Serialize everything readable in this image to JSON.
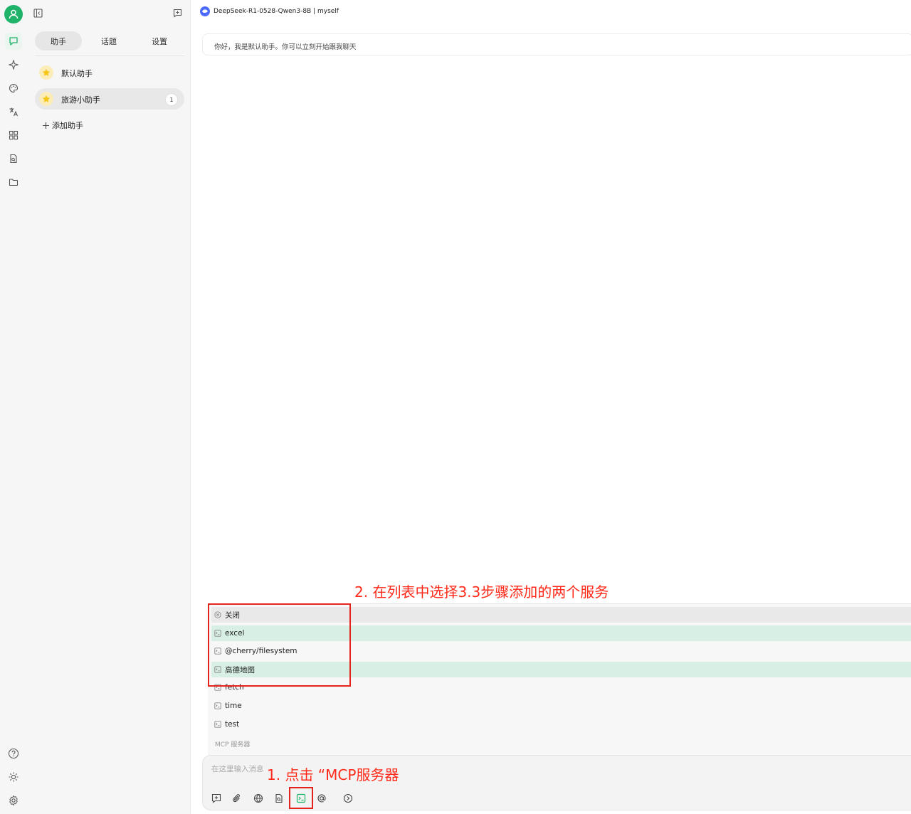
{
  "header": {
    "model_title": "DeepSeek-R1-0528-Qwen3-8B | myself"
  },
  "rail": {
    "icons": [
      "user-avatar-icon",
      "chat-icon",
      "sparkle-icon",
      "palette-icon",
      "translate-icon",
      "apps-grid-icon",
      "doc-search-icon",
      "folder-icon",
      "help-icon",
      "brightness-icon",
      "settings-icon"
    ],
    "accent_color": "#1fb36a"
  },
  "sidebar": {
    "tabs": [
      {
        "label": "助手"
      },
      {
        "label": "话题"
      },
      {
        "label": "设置"
      }
    ],
    "assistants": [
      {
        "label": "默认助手",
        "emoji": "⭐"
      },
      {
        "label": "旅游小助手",
        "emoji": "⭐",
        "count": "1"
      }
    ],
    "add_label": "添加助手"
  },
  "chat": {
    "welcome": "你好，我是默认助手。你可以立刻开始跟我聊天"
  },
  "mcp_menu": {
    "items": [
      {
        "label": "关闭",
        "icon": "close-circle-icon"
      },
      {
        "label": "excel",
        "icon": "terminal-icon"
      },
      {
        "label": "@cherry/filesystem",
        "icon": "terminal-icon"
      },
      {
        "label": "高德地图",
        "icon": "terminal-icon"
      },
      {
        "label": "fetch",
        "icon": "terminal-icon"
      },
      {
        "label": "time",
        "icon": "terminal-icon"
      },
      {
        "label": "test",
        "icon": "terminal-icon"
      }
    ],
    "footer": "MCP 服务器",
    "selected_color": "#d7efe4"
  },
  "composer": {
    "placeholder": "在这里输入消息",
    "tools": [
      "new-topic-icon",
      "attachment-icon",
      "web-search-icon",
      "knowledge-icon",
      "mcp-terminal-icon",
      "mention-icon",
      "expand-icon"
    ]
  },
  "annotations": {
    "step1": "1. 点击 “MCP服务器",
    "step2": "2. 在列表中选择3.3步骤添加的两个服务",
    "color": "#ff2a1a"
  }
}
